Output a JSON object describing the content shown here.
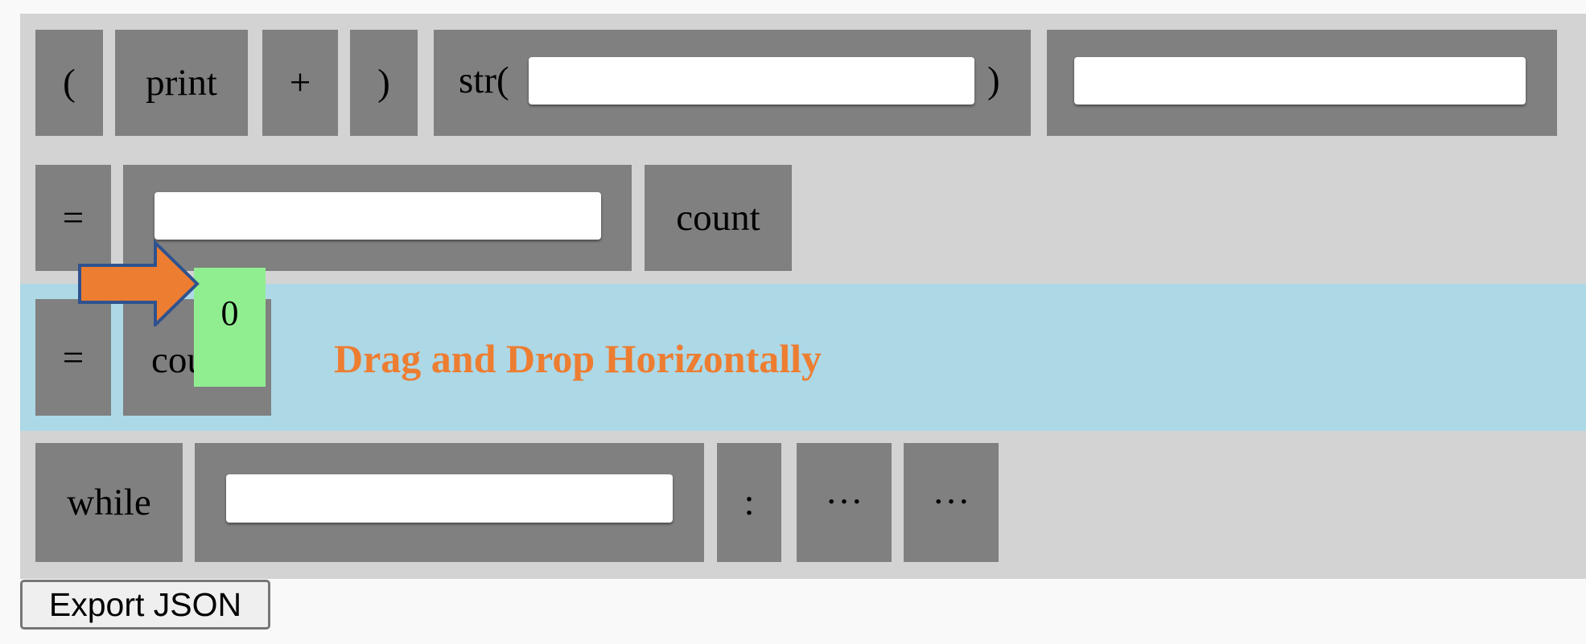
{
  "row1": {
    "lparen": "(",
    "print": "print",
    "plus": "+",
    "rparen": ")",
    "str_prefix": "str(",
    "str_suffix": ")",
    "str_input": "",
    "expr_input": ""
  },
  "row2": {
    "equals": "=",
    "value_input": "",
    "count": "count"
  },
  "row3": {
    "equals": "=",
    "count_partial": "cou",
    "dragged_value": "0",
    "hint": "Drag and Drop Horizontally"
  },
  "row4": {
    "while": "while",
    "condition_input": "",
    "colon": ":",
    "ellipsis_1": "…",
    "ellipsis_2": "…"
  },
  "export_button": "Export JSON",
  "colors": {
    "workspace": "#d3d3d3",
    "block": "#808080",
    "drop_row": "#add8e6",
    "dragged_block": "#90ee90",
    "hint": "#ed7d31",
    "arrow_fill": "#ed7d31",
    "arrow_stroke": "#2f528f"
  }
}
